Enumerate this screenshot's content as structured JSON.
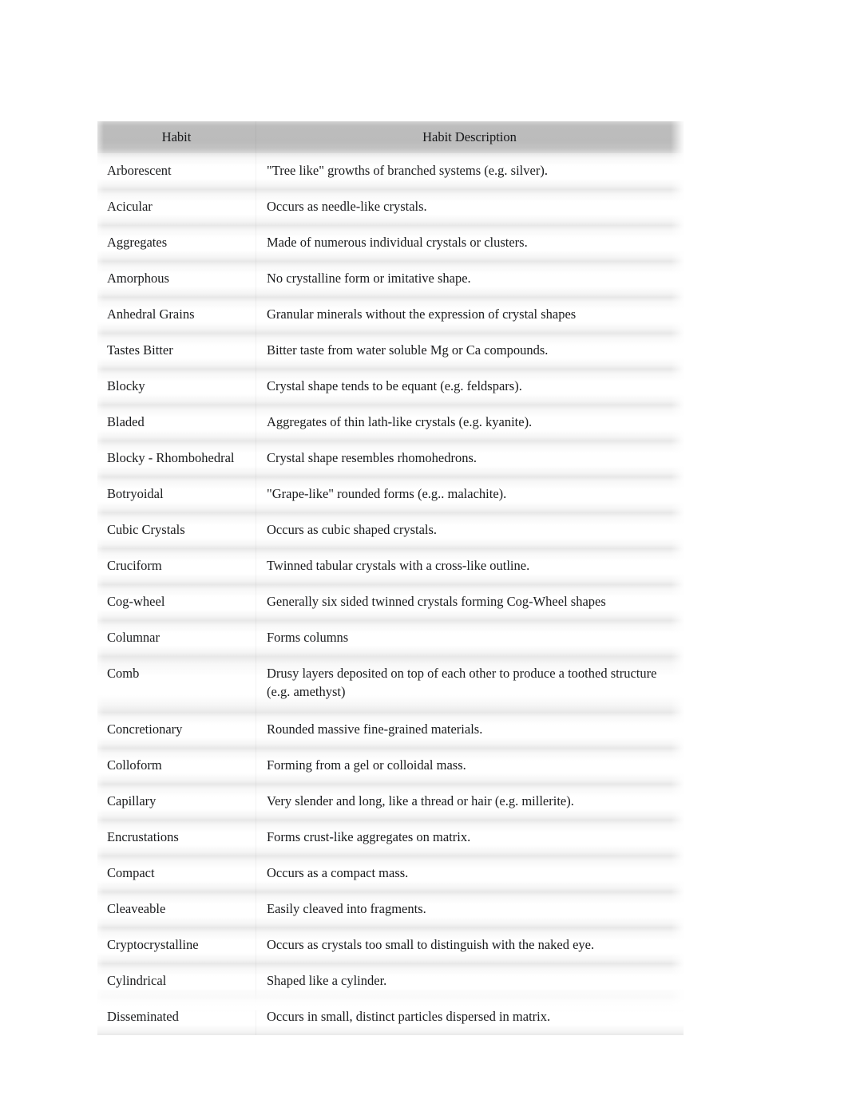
{
  "document": {
    "page_background": "#ffffff",
    "text_color": "#1a1b1d",
    "header_background": "#bbbbbb"
  },
  "table": {
    "name": "mineral-habit-table",
    "columns": [
      {
        "key": "habit",
        "header": "Habit"
      },
      {
        "key": "description",
        "header": "Habit Description"
      }
    ],
    "rows": [
      {
        "habit": "Arborescent",
        "description": "\"Tree like\" growths of branched systems (e.g. silver)."
      },
      {
        "habit": "Acicular",
        "description": "Occurs as needle-like crystals."
      },
      {
        "habit": "Aggregates",
        "description": "Made of numerous individual crystals or clusters."
      },
      {
        "habit": "Amorphous",
        "description": "No crystalline form or imitative shape."
      },
      {
        "habit": "Anhedral Grains",
        "description": "Granular minerals without the expression of crystal shapes"
      },
      {
        "habit": "Tastes Bitter",
        "description": "Bitter taste from water soluble Mg or Ca compounds."
      },
      {
        "habit": "Blocky",
        "description": "Crystal shape tends to be equant (e.g. feldspars)."
      },
      {
        "habit": "Bladed",
        "description": "Aggregates of thin lath-like crystals (e.g. kyanite)."
      },
      {
        "habit": "Blocky - Rhombohedral",
        "description": "Crystal shape resembles rhomohedrons."
      },
      {
        "habit": "Botryoidal",
        "description": "\"Grape-like\" rounded forms (e.g.. malachite)."
      },
      {
        "habit": "Cubic Crystals",
        "description": "Occurs as cubic shaped crystals."
      },
      {
        "habit": "Cruciform",
        "description": "Twinned tabular crystals with a cross-like outline."
      },
      {
        "habit": "Cog-wheel",
        "description": "Generally six sided twinned crystals forming Cog-Wheel shapes"
      },
      {
        "habit": "Columnar",
        "description": "Forms columns"
      },
      {
        "habit": "Comb",
        "description": "Drusy layers deposited on top of each other to produce a toothed structure (e.g. amethyst)"
      },
      {
        "habit": "Concretionary",
        "description": "Rounded massive fine-grained materials."
      },
      {
        "habit": "Colloform",
        "description": "Forming from a gel or colloidal mass."
      },
      {
        "habit": "Capillary",
        "description": "Very slender and long, like a thread or hair (e.g. millerite)."
      },
      {
        "habit": "Encrustations",
        "description": "Forms crust-like aggregates on matrix."
      },
      {
        "habit": "Compact",
        "description": "Occurs as a compact mass."
      },
      {
        "habit": "Cleaveable",
        "description": "Easily cleaved into fragments."
      },
      {
        "habit": "Cryptocrystalline",
        "description": "Occurs as crystals too small to distinguish with the naked eye."
      },
      {
        "habit": "Cylindrical",
        "description": "Shaped like a cylinder."
      },
      {
        "habit": "Disseminated",
        "description": "Occurs in small, distinct particles dispersed in matrix."
      }
    ]
  }
}
